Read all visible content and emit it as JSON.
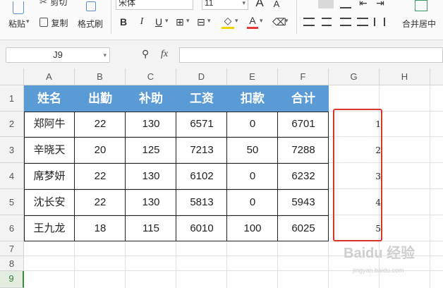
{
  "ribbon": {
    "cut_label": "剪切",
    "paste_label": "粘贴",
    "copy_label": "复制",
    "format_painter_label": "格式刷",
    "font_name": "宋体",
    "font_size": "11",
    "bold": "B",
    "italic": "I",
    "underline": "U",
    "increase_font": "A",
    "decrease_font": "A",
    "font_color_glyph": "A",
    "merge_center_label": "合并居中"
  },
  "formula_bar": {
    "name_box": "J9",
    "fx": "fx",
    "formula": ""
  },
  "columns": [
    "A",
    "B",
    "C",
    "D",
    "E",
    "F",
    "G",
    "H"
  ],
  "rows": [
    "1",
    "2",
    "3",
    "4",
    "5",
    "6",
    "7",
    "8",
    "9"
  ],
  "table": {
    "headers": [
      "姓名",
      "出勤",
      "补助",
      "工资",
      "扣款",
      "合计"
    ],
    "rows": [
      [
        "郑阿牛",
        "22",
        "130",
        "6571",
        "0",
        "6701"
      ],
      [
        "辛晓天",
        "20",
        "125",
        "7213",
        "50",
        "7288"
      ],
      [
        "席梦妍",
        "22",
        "130",
        "6102",
        "0",
        "6232"
      ],
      [
        "沈长安",
        "22",
        "130",
        "5813",
        "0",
        "5943"
      ],
      [
        "王九龙",
        "18",
        "115",
        "6010",
        "100",
        "6025"
      ]
    ]
  },
  "g_column_values": [
    "1",
    "2",
    "3",
    "4",
    "5"
  ],
  "watermark": {
    "main": "Baidu 经验",
    "sub": "jingyan.baidu.com"
  },
  "colors": {
    "header_fill": "#5b9bd5",
    "highlight_border": "#d9362b"
  }
}
